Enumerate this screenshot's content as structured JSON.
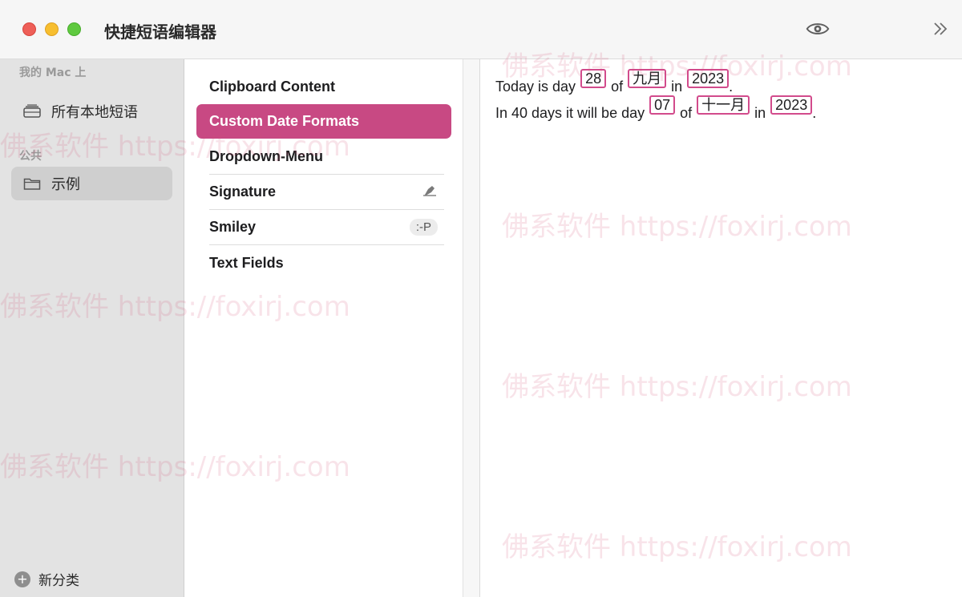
{
  "window": {
    "title": "快捷短语编辑器"
  },
  "toolbar": {
    "sidebar_icon": "sidebar-toggle-icon",
    "preview_icon": "eye-icon",
    "more_icon": "chevron-double-right-icon"
  },
  "sidebar": {
    "section_mac": "我的 Mac 上",
    "all_local": "所有本地短语",
    "section_public": "公共",
    "example": "示例",
    "new_category": "新分类"
  },
  "snippets": [
    {
      "label": "Clipboard Content"
    },
    {
      "label": "Custom Date Formats"
    },
    {
      "label": "Dropdown-Menu"
    },
    {
      "label": "Signature"
    },
    {
      "label": "Smiley",
      "badge": ":-P"
    },
    {
      "label": "Text Fields"
    }
  ],
  "editor": {
    "line1": {
      "t1": "Today is day",
      "day": "28",
      "t2": "of",
      "month": "九月",
      "t3": "in",
      "year": "2023",
      "t4": "."
    },
    "line2": {
      "t1": "In 40 days it will be day",
      "day": "07",
      "t2": "of",
      "month": "十一月",
      "t3": "in",
      "year": "2023",
      "t4": "."
    }
  },
  "watermark": "佛系软件 https://foxirj.com",
  "colors": {
    "accent": "#c84983",
    "token_border": "#d24b8c"
  }
}
